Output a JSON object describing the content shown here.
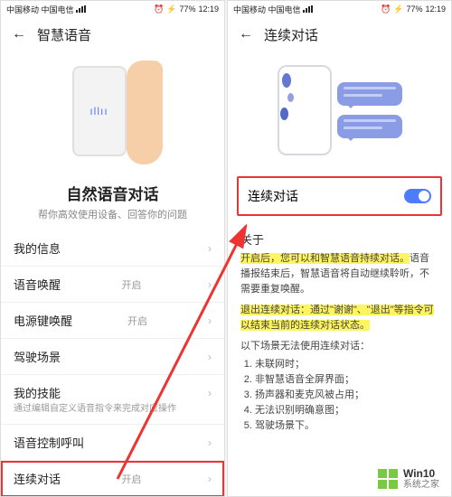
{
  "statusbar": {
    "carriers": "中国移动 中国电信",
    "battery": "77%",
    "time": "12:19"
  },
  "left": {
    "header_title": "智慧语音",
    "hero_title": "自然语音对话",
    "hero_subtitle": "帮你高效使用设备、回答你的问题",
    "menu": {
      "my_info": "我的信息",
      "voice_wake": "语音唤醒",
      "voice_wake_status": "开启",
      "power_wake": "电源键唤醒",
      "power_wake_status": "开启",
      "drive_scene": "驾驶场景",
      "my_skills": "我的技能",
      "my_skills_sub": "通过编辑自定义语音指令来完成对应操作",
      "voice_control_call": "语音控制呼叫",
      "continuous_dialog": "连续对话",
      "continuous_dialog_status": "开启"
    }
  },
  "right": {
    "header_title": "连续对话",
    "toggle_label": "连续对话",
    "about_label": "关于",
    "about": {
      "p1_hl": "开启后，您可以和智慧语音持续对话。",
      "p1_rest": "语音播报结束后，智慧语音将自动继续聆听，不需要重复唤醒。",
      "p2_hl": "退出连续对话：通过\"谢谢\"、\"退出\"等指令可以结束当前的连续对话状态。",
      "list_intro": "以下场景无法使用连续对话：",
      "items": [
        "未联网时；",
        "非智慧语音全屏界面；",
        "扬声器和麦克风被占用；",
        "无法识别明确意图；",
        "驾驶场景下。"
      ]
    }
  },
  "watermark": {
    "line1": "Win10",
    "line2": "系统之家"
  }
}
